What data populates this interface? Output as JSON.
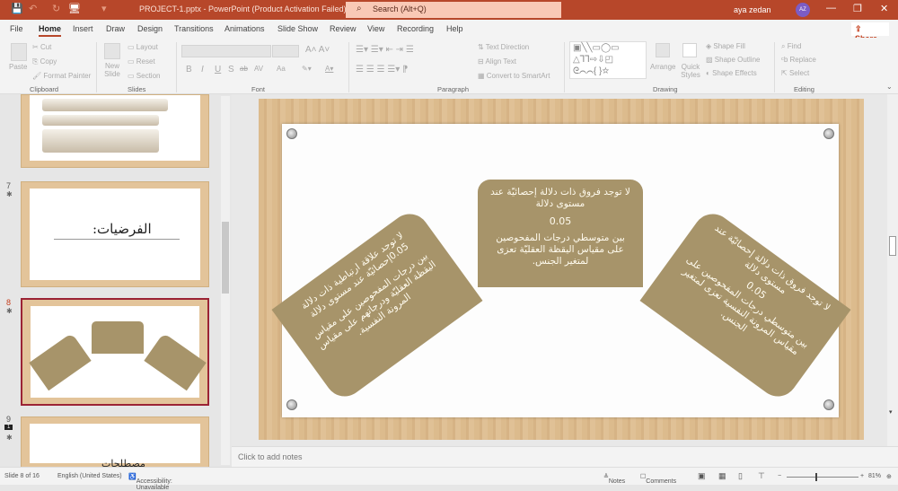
{
  "window": {
    "title": "PROJECT-1.pptx  -  PowerPoint (Product Activation Failed)",
    "search": "Search (Alt+Q)",
    "user": "aya zedan",
    "avatar": "AZ",
    "minimize": "—",
    "restore": "❐",
    "close": "✕"
  },
  "quick_access": {
    "save": "💾",
    "undo": "↶",
    "redo": "↻",
    "present": "🖥",
    "more": "▾"
  },
  "tabs": [
    "File",
    "Home",
    "Insert",
    "Draw",
    "Design",
    "Transitions",
    "Animations",
    "Slide Show",
    "Review",
    "View",
    "Recording",
    "Help"
  ],
  "share": "Share",
  "ribbon": {
    "clipboard": {
      "paste": "Paste",
      "cut": "Cut",
      "copy": "Copy",
      "format_painter": "Format Painter",
      "label": "Clipboard"
    },
    "slides": {
      "new_slide": "New Slide",
      "layout": "Layout",
      "reset": "Reset",
      "section": "Section",
      "label": "Slides"
    },
    "font": {
      "bold": "B",
      "italic": "I",
      "underline": "U",
      "shadow": "S",
      "strike": "ab",
      "spacing": "AV",
      "case": "Aa",
      "label": "Font"
    },
    "paragraph": {
      "text_direction": "Text Direction",
      "align_text": "Align Text",
      "smartart": "Convert to SmartArt",
      "label": "Paragraph"
    },
    "drawing": {
      "arrange": "Arrange",
      "quick_styles": "Quick Styles",
      "shape_fill": "Shape Fill",
      "shape_outline": "Shape Outline",
      "shape_effects": "Shape Effects",
      "label": "Drawing"
    },
    "editing": {
      "find": "Find",
      "replace": "Replace",
      "select": "Select",
      "label": "Editing"
    }
  },
  "thumbnails": [
    {
      "num": "7",
      "text": "الفرضيات:"
    },
    {
      "num": "8"
    },
    {
      "num": "9",
      "comments": "1",
      "text": "مصطلحات"
    }
  ],
  "slide": {
    "center": {
      "line1": "لا توجد فروق ذات دلالة إحصائيّة عند مستوى دلالة",
      "value": "0.05",
      "line2": "بين متوسطي درجات المفحوصين على مقياس اليقظة العقليّة تعزى لمتغير الجنس."
    },
    "left": {
      "line1": "لا توجد علاقة ارتباطية ذات دلالة 0.05إحصائيّة  عند مستوى دلالة",
      "line2": "بين درجات المفحوصين على مقياس اليقظة العقليّة ودرجاتهم على مقياس المرونة النفسية."
    },
    "right": {
      "line1": "لا توجد فروق ذات دلالة إحصائيّة عند مستوى دلالة",
      "value": "0.05",
      "line2": "بين متوسطي درجات المفحوصين على مقياس المرونة النفسية تعزى لمتغير الجنس."
    }
  },
  "notes_placeholder": "Click to add notes",
  "status": {
    "slide": "Slide 8 of 16",
    "language": "English (United States)",
    "accessibility": "Accessibility: Unavailable",
    "notes": "Notes",
    "comments": "Comments",
    "zoom": "81%"
  },
  "colors": {
    "accent": "#b7472a",
    "card": "#a7946a",
    "selected": "#9b2335"
  }
}
